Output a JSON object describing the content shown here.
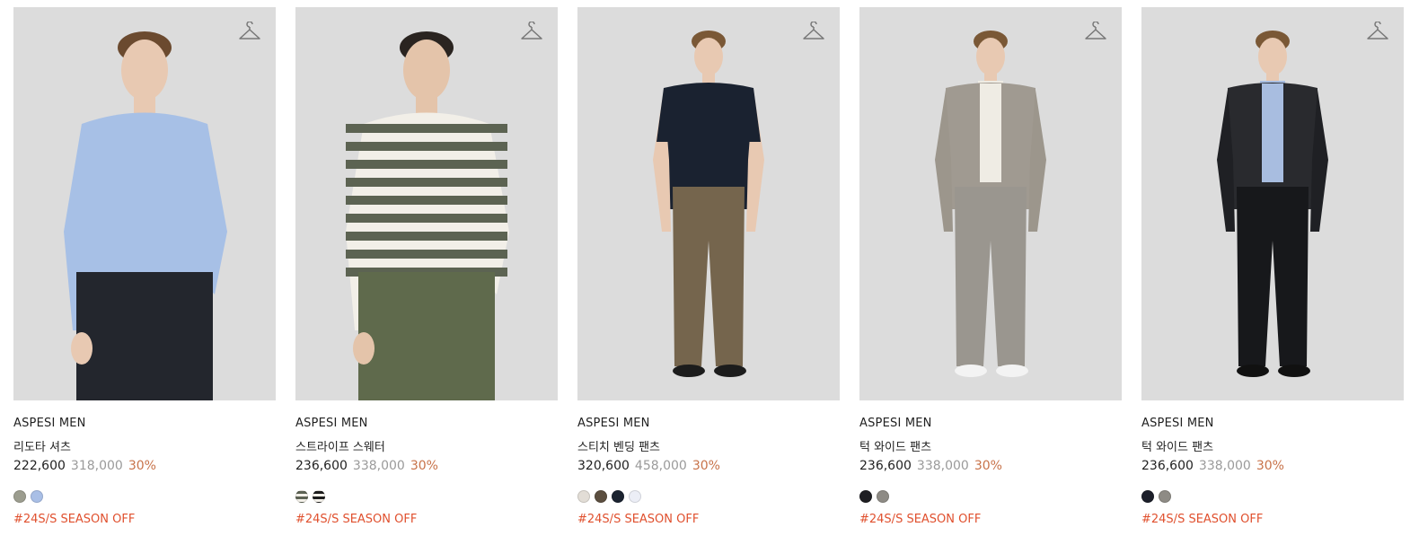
{
  "products": [
    {
      "brand": "ASPESI MEN",
      "name": "리도타 셔츠",
      "price": "222,600",
      "original_price": "318,000",
      "discount": "30%",
      "swatches": [
        "#9c9d8f",
        "#a9bfe6"
      ],
      "tag": "#24S/S SEASON OFF",
      "figure": {
        "top": "#a7c0e6",
        "bottom": "#23262d",
        "skin": "#e8c9b2",
        "hair": "#6b4a2f",
        "shoes": "",
        "bg": "#dcdcdc"
      }
    },
    {
      "brand": "ASPESI MEN",
      "name": "스트라이프 스웨터",
      "price": "236,600",
      "original_price": "338,000",
      "discount": "30%",
      "swatches": [
        "stripe-grey",
        "stripe-black"
      ],
      "tag": "#24S/S SEASON OFF",
      "figure": {
        "top": "#f2efe8",
        "bottom": "#5f6a4c",
        "skin": "#e4c4aa",
        "hair": "#2a2420",
        "shoes": "",
        "bg": "#dcdcdc"
      }
    },
    {
      "brand": "ASPESI MEN",
      "name": "스티치 벤딩 팬츠",
      "price": "320,600",
      "original_price": "458,000",
      "discount": "30%",
      "swatches": [
        "#e2ddd6",
        "#5b4e3f",
        "#1b2330",
        "#eceef6"
      ],
      "tag": "#24S/S SEASON OFF",
      "figure": {
        "top": "#1a2230",
        "bottom": "#75654d",
        "skin": "#e8c9b2",
        "hair": "#7a5836",
        "shoes": "#1c1c1c",
        "bg": "#dcdcdc"
      }
    },
    {
      "brand": "ASPESI MEN",
      "name": "턱 와이드 팬츠",
      "price": "236,600",
      "original_price": "338,000",
      "discount": "30%",
      "swatches": [
        "#1e1e22",
        "#8e8b85"
      ],
      "tag": "#24S/S SEASON OFF",
      "figure": {
        "top": "#9c968c",
        "bottom": "#9a968f",
        "skin": "#e8c9b2",
        "hair": "#7a5836",
        "shoes": "#f3f3f3",
        "bg": "#dcdcdc"
      }
    },
    {
      "brand": "ASPESI MEN",
      "name": "턱 와이드 팬츠",
      "price": "236,600",
      "original_price": "338,000",
      "discount": "30%",
      "swatches": [
        "#1c1f2a",
        "#8e8b85"
      ],
      "tag": "#24S/S SEASON OFF",
      "figure": {
        "top": "#1f2024",
        "bottom": "#17181b",
        "skin": "#e8c9b2",
        "hair": "#7a5836",
        "shoes": "#111111",
        "bg": "#dcdcdc"
      }
    }
  ]
}
